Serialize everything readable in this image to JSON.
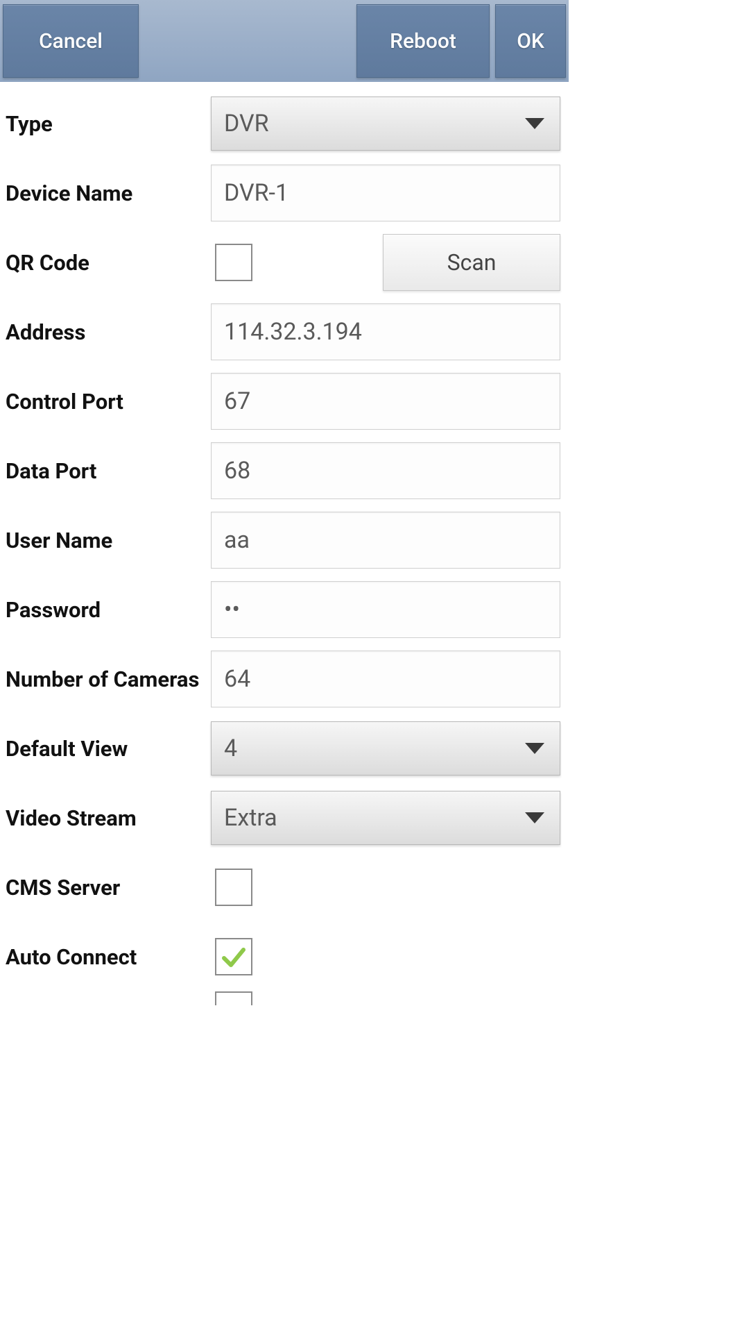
{
  "header": {
    "cancel": "Cancel",
    "reboot": "Reboot",
    "ok": "OK"
  },
  "labels": {
    "type": "Type",
    "device_name": "Device Name",
    "qr_code": "QR Code",
    "address": "Address",
    "control_port": "Control Port",
    "data_port": "Data Port",
    "user_name": "User Name",
    "password": "Password",
    "num_cameras": "Number of Cameras",
    "default_view": "Default View",
    "video_stream": "Video Stream",
    "cms_server": "CMS Server",
    "auto_connect": "Auto Connect"
  },
  "values": {
    "type": "DVR",
    "device_name": "DVR-1",
    "qr_code_checked": false,
    "scan": "Scan",
    "address": "114.32.3.194",
    "control_port": "67",
    "data_port": "68",
    "user_name": "aa",
    "password": "••",
    "num_cameras": "64",
    "default_view": "4",
    "video_stream": "Extra",
    "cms_server_checked": false,
    "auto_connect_checked": true
  }
}
